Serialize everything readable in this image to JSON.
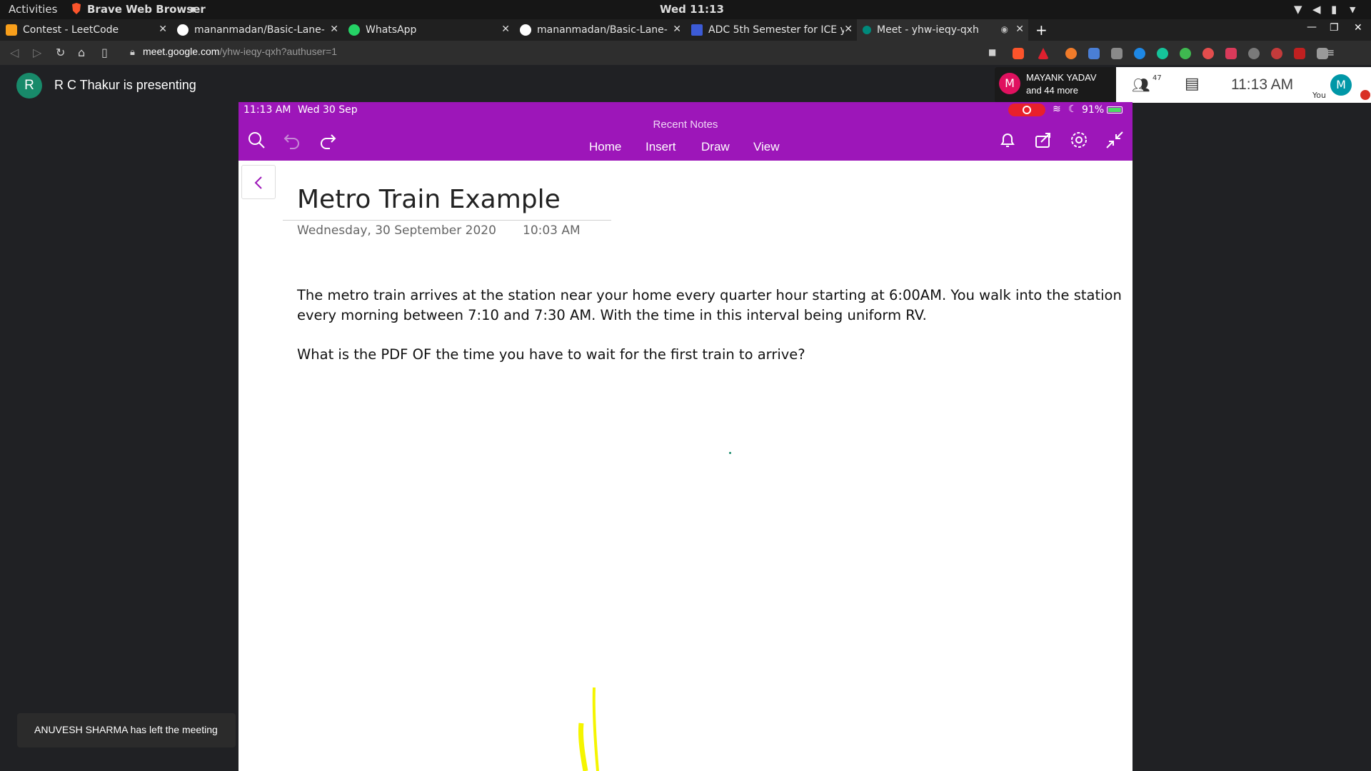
{
  "system_bar": {
    "activities": "Activities",
    "app_name": "Brave Web Browser",
    "clock": "Wed 11:13"
  },
  "tabs": [
    {
      "title": "Contest - LeetCode",
      "icon": "leetcode-icon",
      "color": "#f89f1b"
    },
    {
      "title": "mananmadan/Basic-Lane-",
      "icon": "github-icon",
      "color": "#ffffff"
    },
    {
      "title": "WhatsApp",
      "icon": "whatsapp-icon",
      "color": "#25d366"
    },
    {
      "title": "mananmadan/Basic-Lane-",
      "icon": "github-icon",
      "color": "#ffffff"
    },
    {
      "title": "ADC 5th Semester for ICE y",
      "icon": "classroom-icon",
      "color": "#3c5bd6"
    },
    {
      "title": "Meet - yhw-ieqy-qxh",
      "icon": "meet-icon",
      "color": "#00897b",
      "active": true
    }
  ],
  "address_bar": {
    "url_host": "meet.google.com",
    "url_path": "/yhw-ieqy-qxh?authuser=1"
  },
  "meet": {
    "presenter_initial": "R",
    "presenting_text": "R C Thakur is presenting",
    "participant_initial": "M",
    "participant_name": "MAYANK YADAV",
    "participant_more": "and 44 more",
    "people_count": "47",
    "time": "11:13  AM",
    "self_initial": "M",
    "self_label": "You",
    "toast": "ANUVESH SHARMA has left the meeting"
  },
  "onenote": {
    "status_time": "11:13 AM",
    "status_date": "Wed 30 Sep",
    "battery": "91%",
    "notebook_label": "Recent Notes",
    "tabs": [
      "Home",
      "Insert",
      "Draw",
      "View"
    ],
    "note_title": "Metro Train Example",
    "note_date": "Wednesday, 30 September 2020",
    "note_time": "10:03 AM",
    "para1_line1": "The metro train arrives at the station near your home every quarter hour starting at 6:00AM.  You walk into the station",
    "para1_line2": "every morning between 7:10 and 7:30 AM. With the time in this interval being uniform RV.",
    "para2": "What is the PDF OF the time you have to wait for the first train to arrive?"
  },
  "colors": {
    "onenote_purple": "#9d16b9",
    "ink_yellow": "#f5f500"
  }
}
